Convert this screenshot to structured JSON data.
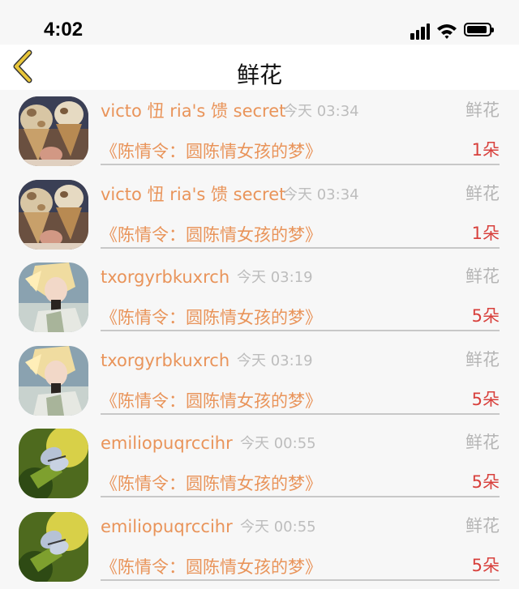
{
  "status_bar": {
    "time": "4:02",
    "icons": [
      "cellular-signal-icon",
      "wifi-icon",
      "battery-icon"
    ]
  },
  "nav": {
    "title": "鲜花",
    "back_icon": "chevron-left-icon",
    "accent_color": "#e9c63a"
  },
  "colors": {
    "username": "#e9945a",
    "time": "#bdbdbd",
    "gift_type": "#b5b5b5",
    "count": "#d8403c"
  },
  "gifts": [
    {
      "username": "victo 忸 ria's 馈 secret",
      "time": "今天 03:34",
      "type": "鲜花",
      "drama": "《陈情令：圆陈情女孩的梦》",
      "count": "1朵",
      "avatar": "ice-cream-avatar"
    },
    {
      "username": "victo 忸 ria's 馈 secret",
      "time": "今天 03:34",
      "type": "鲜花",
      "drama": "《陈情令：圆陈情女孩的梦》",
      "count": "1朵",
      "avatar": "ice-cream-avatar"
    },
    {
      "username": "txorgyrbkuxrch",
      "time": "今天 03:19",
      "type": "鲜花",
      "drama": "《陈情令：圆陈情女孩的梦》",
      "count": "5朵",
      "avatar": "anime-character-avatar"
    },
    {
      "username": "txorgyrbkuxrch",
      "time": "今天 03:19",
      "type": "鲜花",
      "drama": "《陈情令：圆陈情女孩的梦》",
      "count": "5朵",
      "avatar": "anime-character-avatar"
    },
    {
      "username": "emiliopuqrccihr",
      "time": "今天 00:55",
      "type": "鲜花",
      "drama": "《陈情令：圆陈情女孩的梦》",
      "count": "5朵",
      "avatar": "butterfly-avatar"
    },
    {
      "username": "emiliopuqrccihr",
      "time": "今天 00:55",
      "type": "鲜花",
      "drama": "《陈情令：圆陈情女孩的梦》",
      "count": "5朵",
      "avatar": "butterfly-avatar"
    }
  ]
}
